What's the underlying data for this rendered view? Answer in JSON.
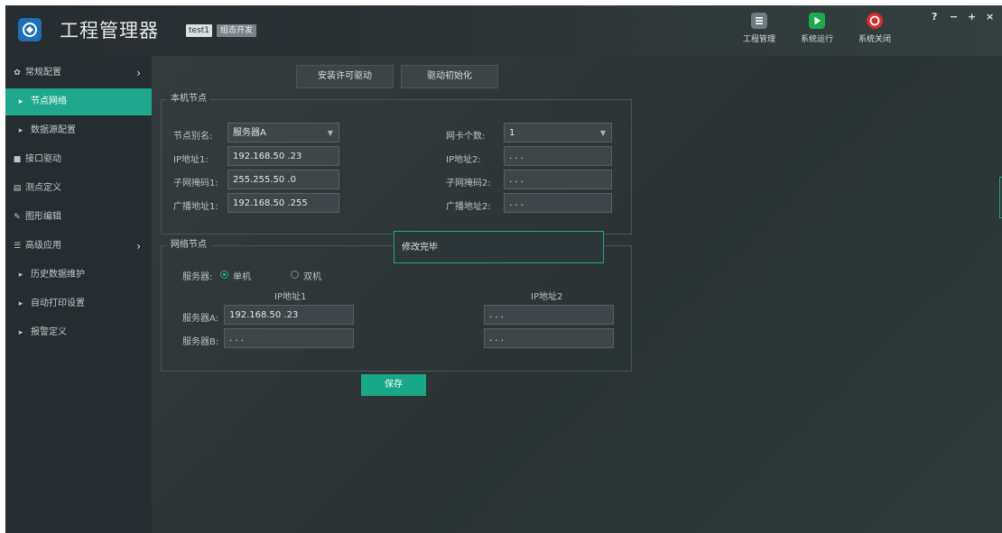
{
  "header": {
    "title": "工程管理器",
    "project": "test1",
    "mode": "组态开发",
    "logo_icon": "app-logo-icon",
    "buttons": [
      {
        "label": "工程管理",
        "icon": "list-icon",
        "color": "#6d7a7f"
      },
      {
        "label": "系统运行",
        "icon": "play-icon",
        "color": "#1fa84f"
      },
      {
        "label": "系统关闭",
        "icon": "power-icon",
        "color": "#d62b2b"
      }
    ],
    "window_controls": {
      "help": "?",
      "minimize": "−",
      "maximize": "+",
      "close": "×"
    }
  },
  "sidebar": {
    "items": [
      {
        "label": "常规配置",
        "icon": "gear-icon",
        "arrow": "›"
      },
      {
        "label": "节点网络",
        "icon": "bullet-icon",
        "active": true
      },
      {
        "label": "数据源配置",
        "icon": "bullet-icon"
      },
      {
        "label": "接口驱动",
        "icon": "square-icon"
      },
      {
        "label": "测点定义",
        "icon": "database-icon"
      },
      {
        "label": "图形编辑",
        "icon": "edit-icon"
      },
      {
        "label": "高级应用",
        "icon": "sliders-icon",
        "arrow": "›"
      },
      {
        "label": "历史数据维护",
        "icon": "bullet-icon"
      },
      {
        "label": "自动打印设置",
        "icon": "bullet-icon"
      },
      {
        "label": "报警定义",
        "icon": "bullet-icon"
      }
    ]
  },
  "main": {
    "top_buttons": [
      "安装许可驱动",
      "驱动初始化"
    ],
    "local_node": {
      "title": "本机节点",
      "alias_label": "节点别名:",
      "alias_value": "服务器A",
      "nic_count_label": "网卡个数:",
      "nic_count_value": "1",
      "ip1_label": "IP地址1:",
      "ip1_value": "192.168.50 .23",
      "ip2_label": "IP地址2:",
      "ip2_value": ". . .",
      "mask1_label": "子网掩码1:",
      "mask1_value": "255.255.50 .0",
      "mask2_label": "子网掩码2:",
      "mask2_value": ". . .",
      "bcast1_label": "广播地址1:",
      "bcast1_value": "192.168.50 .255",
      "bcast2_label": "广播地址2:",
      "bcast2_value": ". . ."
    },
    "toast": "修改完毕",
    "network_node": {
      "title": "网络节点",
      "server_label": "服务器:",
      "single_label": "单机",
      "dual_label": "双机",
      "selected": "单机",
      "col1_header": "IP地址1",
      "col2_header": "IP地址2",
      "serverA_label": "服务器A:",
      "serverA_ip1": "192.168.50 .23",
      "serverA_ip2": ". . .",
      "serverB_label": "服务器B:",
      "serverB_ip1": ". . .",
      "serverB_ip2": ". . ."
    },
    "save_label": "保存"
  },
  "colors": {
    "accent": "#1fa88c",
    "sidebar_bg": "#262d30",
    "main_bg": "#2f3739"
  }
}
